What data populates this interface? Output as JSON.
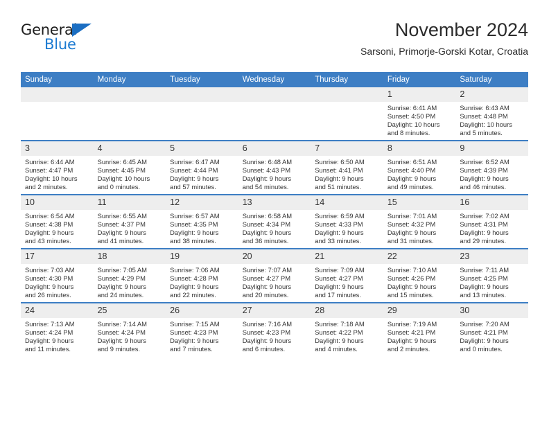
{
  "brand": {
    "name_part1": "General",
    "name_part2": "Blue",
    "triangle_color": "#1b6ec2",
    "blue_color": "#1b7ad1"
  },
  "header": {
    "title": "November 2024",
    "subtitle": "Sarsoni, Primorje-Gorski Kotar, Croatia"
  },
  "theme": {
    "header_blue": "#3d7ec4",
    "daynum_band": "#eeeeee",
    "text": "#333333"
  },
  "calendar": {
    "weekdays": [
      "Sunday",
      "Monday",
      "Tuesday",
      "Wednesday",
      "Thursday",
      "Friday",
      "Saturday"
    ],
    "weeks": [
      [
        {
          "day": "",
          "sunrise": "",
          "sunset": "",
          "daylight1": "",
          "daylight2": ""
        },
        {
          "day": "",
          "sunrise": "",
          "sunset": "",
          "daylight1": "",
          "daylight2": ""
        },
        {
          "day": "",
          "sunrise": "",
          "sunset": "",
          "daylight1": "",
          "daylight2": ""
        },
        {
          "day": "",
          "sunrise": "",
          "sunset": "",
          "daylight1": "",
          "daylight2": ""
        },
        {
          "day": "",
          "sunrise": "",
          "sunset": "",
          "daylight1": "",
          "daylight2": ""
        },
        {
          "day": "1",
          "sunrise": "Sunrise: 6:41 AM",
          "sunset": "Sunset: 4:50 PM",
          "daylight1": "Daylight: 10 hours",
          "daylight2": "and 8 minutes."
        },
        {
          "day": "2",
          "sunrise": "Sunrise: 6:43 AM",
          "sunset": "Sunset: 4:48 PM",
          "daylight1": "Daylight: 10 hours",
          "daylight2": "and 5 minutes."
        }
      ],
      [
        {
          "day": "3",
          "sunrise": "Sunrise: 6:44 AM",
          "sunset": "Sunset: 4:47 PM",
          "daylight1": "Daylight: 10 hours",
          "daylight2": "and 2 minutes."
        },
        {
          "day": "4",
          "sunrise": "Sunrise: 6:45 AM",
          "sunset": "Sunset: 4:45 PM",
          "daylight1": "Daylight: 10 hours",
          "daylight2": "and 0 minutes."
        },
        {
          "day": "5",
          "sunrise": "Sunrise: 6:47 AM",
          "sunset": "Sunset: 4:44 PM",
          "daylight1": "Daylight: 9 hours",
          "daylight2": "and 57 minutes."
        },
        {
          "day": "6",
          "sunrise": "Sunrise: 6:48 AM",
          "sunset": "Sunset: 4:43 PM",
          "daylight1": "Daylight: 9 hours",
          "daylight2": "and 54 minutes."
        },
        {
          "day": "7",
          "sunrise": "Sunrise: 6:50 AM",
          "sunset": "Sunset: 4:41 PM",
          "daylight1": "Daylight: 9 hours",
          "daylight2": "and 51 minutes."
        },
        {
          "day": "8",
          "sunrise": "Sunrise: 6:51 AM",
          "sunset": "Sunset: 4:40 PM",
          "daylight1": "Daylight: 9 hours",
          "daylight2": "and 49 minutes."
        },
        {
          "day": "9",
          "sunrise": "Sunrise: 6:52 AM",
          "sunset": "Sunset: 4:39 PM",
          "daylight1": "Daylight: 9 hours",
          "daylight2": "and 46 minutes."
        }
      ],
      [
        {
          "day": "10",
          "sunrise": "Sunrise: 6:54 AM",
          "sunset": "Sunset: 4:38 PM",
          "daylight1": "Daylight: 9 hours",
          "daylight2": "and 43 minutes."
        },
        {
          "day": "11",
          "sunrise": "Sunrise: 6:55 AM",
          "sunset": "Sunset: 4:37 PM",
          "daylight1": "Daylight: 9 hours",
          "daylight2": "and 41 minutes."
        },
        {
          "day": "12",
          "sunrise": "Sunrise: 6:57 AM",
          "sunset": "Sunset: 4:35 PM",
          "daylight1": "Daylight: 9 hours",
          "daylight2": "and 38 minutes."
        },
        {
          "day": "13",
          "sunrise": "Sunrise: 6:58 AM",
          "sunset": "Sunset: 4:34 PM",
          "daylight1": "Daylight: 9 hours",
          "daylight2": "and 36 minutes."
        },
        {
          "day": "14",
          "sunrise": "Sunrise: 6:59 AM",
          "sunset": "Sunset: 4:33 PM",
          "daylight1": "Daylight: 9 hours",
          "daylight2": "and 33 minutes."
        },
        {
          "day": "15",
          "sunrise": "Sunrise: 7:01 AM",
          "sunset": "Sunset: 4:32 PM",
          "daylight1": "Daylight: 9 hours",
          "daylight2": "and 31 minutes."
        },
        {
          "day": "16",
          "sunrise": "Sunrise: 7:02 AM",
          "sunset": "Sunset: 4:31 PM",
          "daylight1": "Daylight: 9 hours",
          "daylight2": "and 29 minutes."
        }
      ],
      [
        {
          "day": "17",
          "sunrise": "Sunrise: 7:03 AM",
          "sunset": "Sunset: 4:30 PM",
          "daylight1": "Daylight: 9 hours",
          "daylight2": "and 26 minutes."
        },
        {
          "day": "18",
          "sunrise": "Sunrise: 7:05 AM",
          "sunset": "Sunset: 4:29 PM",
          "daylight1": "Daylight: 9 hours",
          "daylight2": "and 24 minutes."
        },
        {
          "day": "19",
          "sunrise": "Sunrise: 7:06 AM",
          "sunset": "Sunset: 4:28 PM",
          "daylight1": "Daylight: 9 hours",
          "daylight2": "and 22 minutes."
        },
        {
          "day": "20",
          "sunrise": "Sunrise: 7:07 AM",
          "sunset": "Sunset: 4:27 PM",
          "daylight1": "Daylight: 9 hours",
          "daylight2": "and 20 minutes."
        },
        {
          "day": "21",
          "sunrise": "Sunrise: 7:09 AM",
          "sunset": "Sunset: 4:27 PM",
          "daylight1": "Daylight: 9 hours",
          "daylight2": "and 17 minutes."
        },
        {
          "day": "22",
          "sunrise": "Sunrise: 7:10 AM",
          "sunset": "Sunset: 4:26 PM",
          "daylight1": "Daylight: 9 hours",
          "daylight2": "and 15 minutes."
        },
        {
          "day": "23",
          "sunrise": "Sunrise: 7:11 AM",
          "sunset": "Sunset: 4:25 PM",
          "daylight1": "Daylight: 9 hours",
          "daylight2": "and 13 minutes."
        }
      ],
      [
        {
          "day": "24",
          "sunrise": "Sunrise: 7:13 AM",
          "sunset": "Sunset: 4:24 PM",
          "daylight1": "Daylight: 9 hours",
          "daylight2": "and 11 minutes."
        },
        {
          "day": "25",
          "sunrise": "Sunrise: 7:14 AM",
          "sunset": "Sunset: 4:24 PM",
          "daylight1": "Daylight: 9 hours",
          "daylight2": "and 9 minutes."
        },
        {
          "day": "26",
          "sunrise": "Sunrise: 7:15 AM",
          "sunset": "Sunset: 4:23 PM",
          "daylight1": "Daylight: 9 hours",
          "daylight2": "and 7 minutes."
        },
        {
          "day": "27",
          "sunrise": "Sunrise: 7:16 AM",
          "sunset": "Sunset: 4:23 PM",
          "daylight1": "Daylight: 9 hours",
          "daylight2": "and 6 minutes."
        },
        {
          "day": "28",
          "sunrise": "Sunrise: 7:18 AM",
          "sunset": "Sunset: 4:22 PM",
          "daylight1": "Daylight: 9 hours",
          "daylight2": "and 4 minutes."
        },
        {
          "day": "29",
          "sunrise": "Sunrise: 7:19 AM",
          "sunset": "Sunset: 4:21 PM",
          "daylight1": "Daylight: 9 hours",
          "daylight2": "and 2 minutes."
        },
        {
          "day": "30",
          "sunrise": "Sunrise: 7:20 AM",
          "sunset": "Sunset: 4:21 PM",
          "daylight1": "Daylight: 9 hours",
          "daylight2": "and 0 minutes."
        }
      ]
    ]
  }
}
